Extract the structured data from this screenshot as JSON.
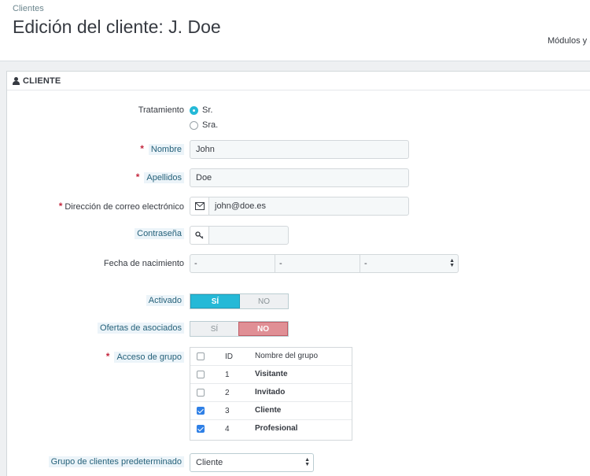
{
  "header": {
    "breadcrumb": "Clientes",
    "title": "Edición del cliente: J. Doe",
    "toolbar_link": "Módulos y S"
  },
  "panel": {
    "heading": "CLIENTE",
    "heading_icon": "user-icon"
  },
  "form": {
    "title_label": "Tratamiento",
    "title_options": [
      "Sr.",
      "Sra."
    ],
    "title_selected": "Sr.",
    "first_name_label": "Nombre",
    "first_name_value": "John",
    "last_name_label": "Apellidos",
    "last_name_value": "Doe",
    "email_label": "Dirección de correo electrónico",
    "email_value": "john@doe.es",
    "email_icon": "envelope-icon",
    "password_label": "Contraseña",
    "password_value": "",
    "password_icon": "key-icon",
    "birthday_label": "Fecha de nacimiento",
    "birthday_day": "-",
    "birthday_month": "-",
    "birthday_year": "-",
    "active_label": "Activado",
    "active_yes": "SÍ",
    "active_no": "NO",
    "active_value": "SÍ",
    "optin_label": "Ofertas de asociados",
    "optin_yes": "SÍ",
    "optin_no": "NO",
    "optin_value": "NO",
    "groups_label": "Acceso de grupo",
    "groups_header_id": "ID",
    "groups_header_name": "Nombre del grupo",
    "groups": [
      {
        "id": "1",
        "name": "Visitante",
        "checked": false
      },
      {
        "id": "2",
        "name": "Invitado",
        "checked": false
      },
      {
        "id": "3",
        "name": "Cliente",
        "checked": true
      },
      {
        "id": "4",
        "name": "Profesional",
        "checked": true
      }
    ],
    "default_group_label": "Grupo de clientes predeterminado",
    "default_group_value": "Cliente",
    "required_mark": "*"
  },
  "colors": {
    "accent": "#25b9d7",
    "required": "#c4283f",
    "no_switch": "#e08f95"
  }
}
